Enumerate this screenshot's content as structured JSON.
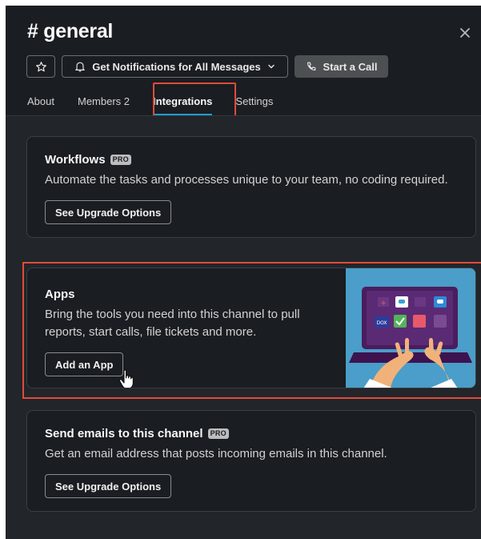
{
  "header": {
    "title": "# general",
    "notifications_label": "Get Notifications for All Messages",
    "call_label": "Start a Call"
  },
  "tabs": [
    {
      "label": "About"
    },
    {
      "label": "Members 2"
    },
    {
      "label": "Integrations",
      "active": true
    },
    {
      "label": "Settings"
    }
  ],
  "cards": {
    "workflows": {
      "title": "Workflows",
      "badge": "PRO",
      "description": "Automate the tasks and processes unique to your team, no coding required.",
      "button": "See Upgrade Options"
    },
    "apps": {
      "title": "Apps",
      "description": "Bring the tools you need into this channel to pull reports, start calls, file tickets and more.",
      "button": "Add an App"
    },
    "email": {
      "title": "Send emails to this channel",
      "badge": "PRO",
      "description": "Get an email address that posts incoming emails in this channel.",
      "button": "See Upgrade Options"
    }
  },
  "colors": {
    "background": "#1a1d21",
    "body": "#222529",
    "highlight": "#e04b3c",
    "tab_underline": "#1d9bd1",
    "illustration": "#4a9ec9"
  },
  "icons": [
    "star-icon",
    "bell-icon",
    "chevron-down-icon",
    "phone-icon",
    "close-icon",
    "hand-cursor-icon"
  ]
}
